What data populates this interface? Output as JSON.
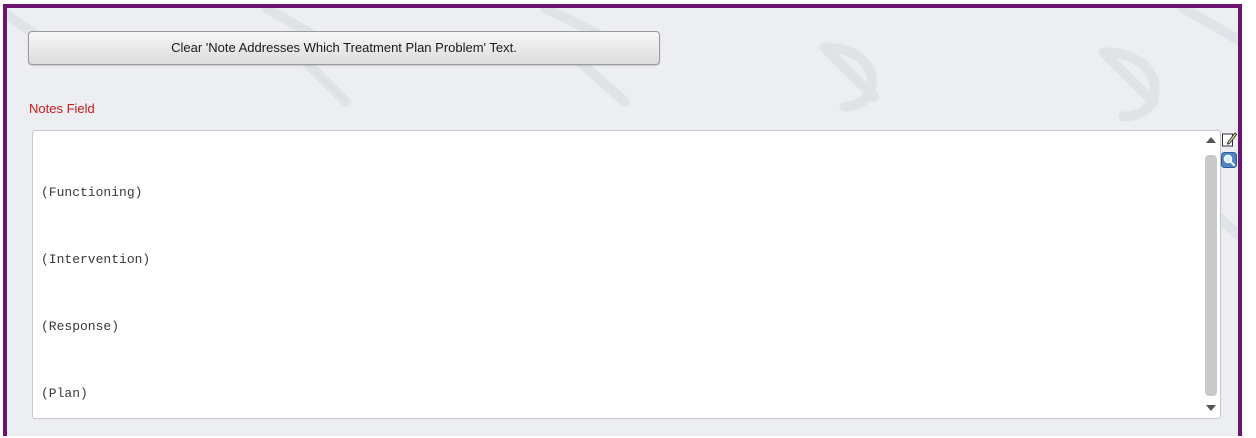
{
  "buttons": {
    "clear_label": "Clear 'Note Addresses Which Treatment Plan Problem' Text."
  },
  "notes": {
    "label": "Notes Field",
    "lines": [
      "(Functioning)",
      "(Intervention)",
      "(Response)",
      "(Plan)"
    ]
  },
  "icons": {
    "edit": "edit-note-icon",
    "zoom": "magnify-icon",
    "scroll_up": "scroll-up-arrow-icon",
    "scroll_down": "scroll-down-arrow-icon"
  },
  "colors": {
    "frame_border": "#6d1470",
    "label_red": "#cc1a1a",
    "background": "#eceef1"
  }
}
